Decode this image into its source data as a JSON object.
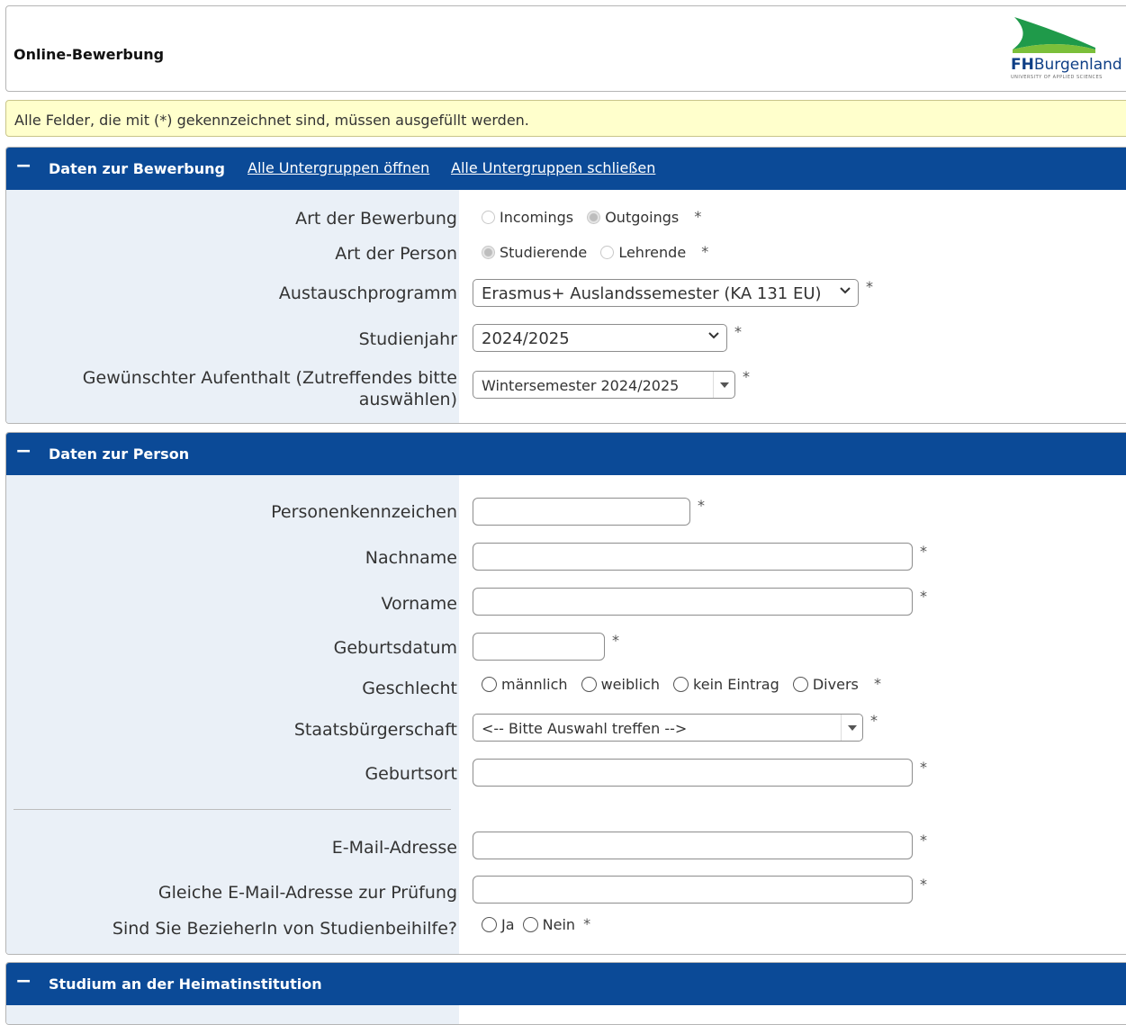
{
  "header": {
    "title": "Online-Bewerbung",
    "logo": {
      "brand_bold": "FH",
      "brand_rest": "Burgenland",
      "tagline": "UNIVERSITY OF APPLIED SCIENCES"
    }
  },
  "notice": "Alle Felder, die mit (*) gekennzeichnet sind, müssen ausgefüllt werden.",
  "required_mark": "*",
  "sections": {
    "bewerbung": {
      "title": "Daten zur Bewerbung",
      "collapse_icon": "−",
      "link_open": "Alle Untergruppen öffnen",
      "link_close": "Alle Untergruppen schließen",
      "art_bewerbung": {
        "label": "Art der Bewerbung",
        "options": [
          "Incomings",
          "Outgoings"
        ],
        "selected": "Outgoings"
      },
      "art_person": {
        "label": "Art der Person",
        "options": [
          "Studierende",
          "Lehrende"
        ],
        "selected": "Studierende"
      },
      "austauschprogramm": {
        "label": "Austauschprogramm",
        "value": "Erasmus+ Auslandssemester (KA 131 EU)"
      },
      "studienjahr": {
        "label": "Studienjahr",
        "value": "2024/2025"
      },
      "aufenthalt": {
        "label": "Gewünschter Aufenthalt (Zutreffendes bitte auswählen)",
        "value": "Wintersemester 2024/2025"
      }
    },
    "person": {
      "title": "Daten zur Person",
      "collapse_icon": "−",
      "personenkennzeichen": {
        "label": "Personenkennzeichen",
        "value": ""
      },
      "nachname": {
        "label": "Nachname",
        "value": ""
      },
      "vorname": {
        "label": "Vorname",
        "value": ""
      },
      "geburtsdatum": {
        "label": "Geburtsdatum",
        "value": ""
      },
      "geschlecht": {
        "label": "Geschlecht",
        "options": [
          "männlich",
          "weiblich",
          "kein Eintrag",
          "Divers"
        ]
      },
      "staatsbuergerschaft": {
        "label": "Staatsbürgerschaft",
        "value": "<-- Bitte Auswahl treffen -->"
      },
      "geburtsort": {
        "label": "Geburtsort",
        "value": ""
      },
      "email": {
        "label": "E-Mail-Adresse",
        "value": ""
      },
      "email_check": {
        "label": "Gleiche E-Mail-Adresse zur Prüfung",
        "value": ""
      },
      "studienbeihilfe": {
        "label": "Sind Sie BezieherIn von Studienbeihilfe?",
        "options": [
          "Ja",
          "Nein"
        ]
      }
    },
    "heimat": {
      "title": "Studium an der Heimatinstitution",
      "collapse_icon": "−"
    }
  }
}
